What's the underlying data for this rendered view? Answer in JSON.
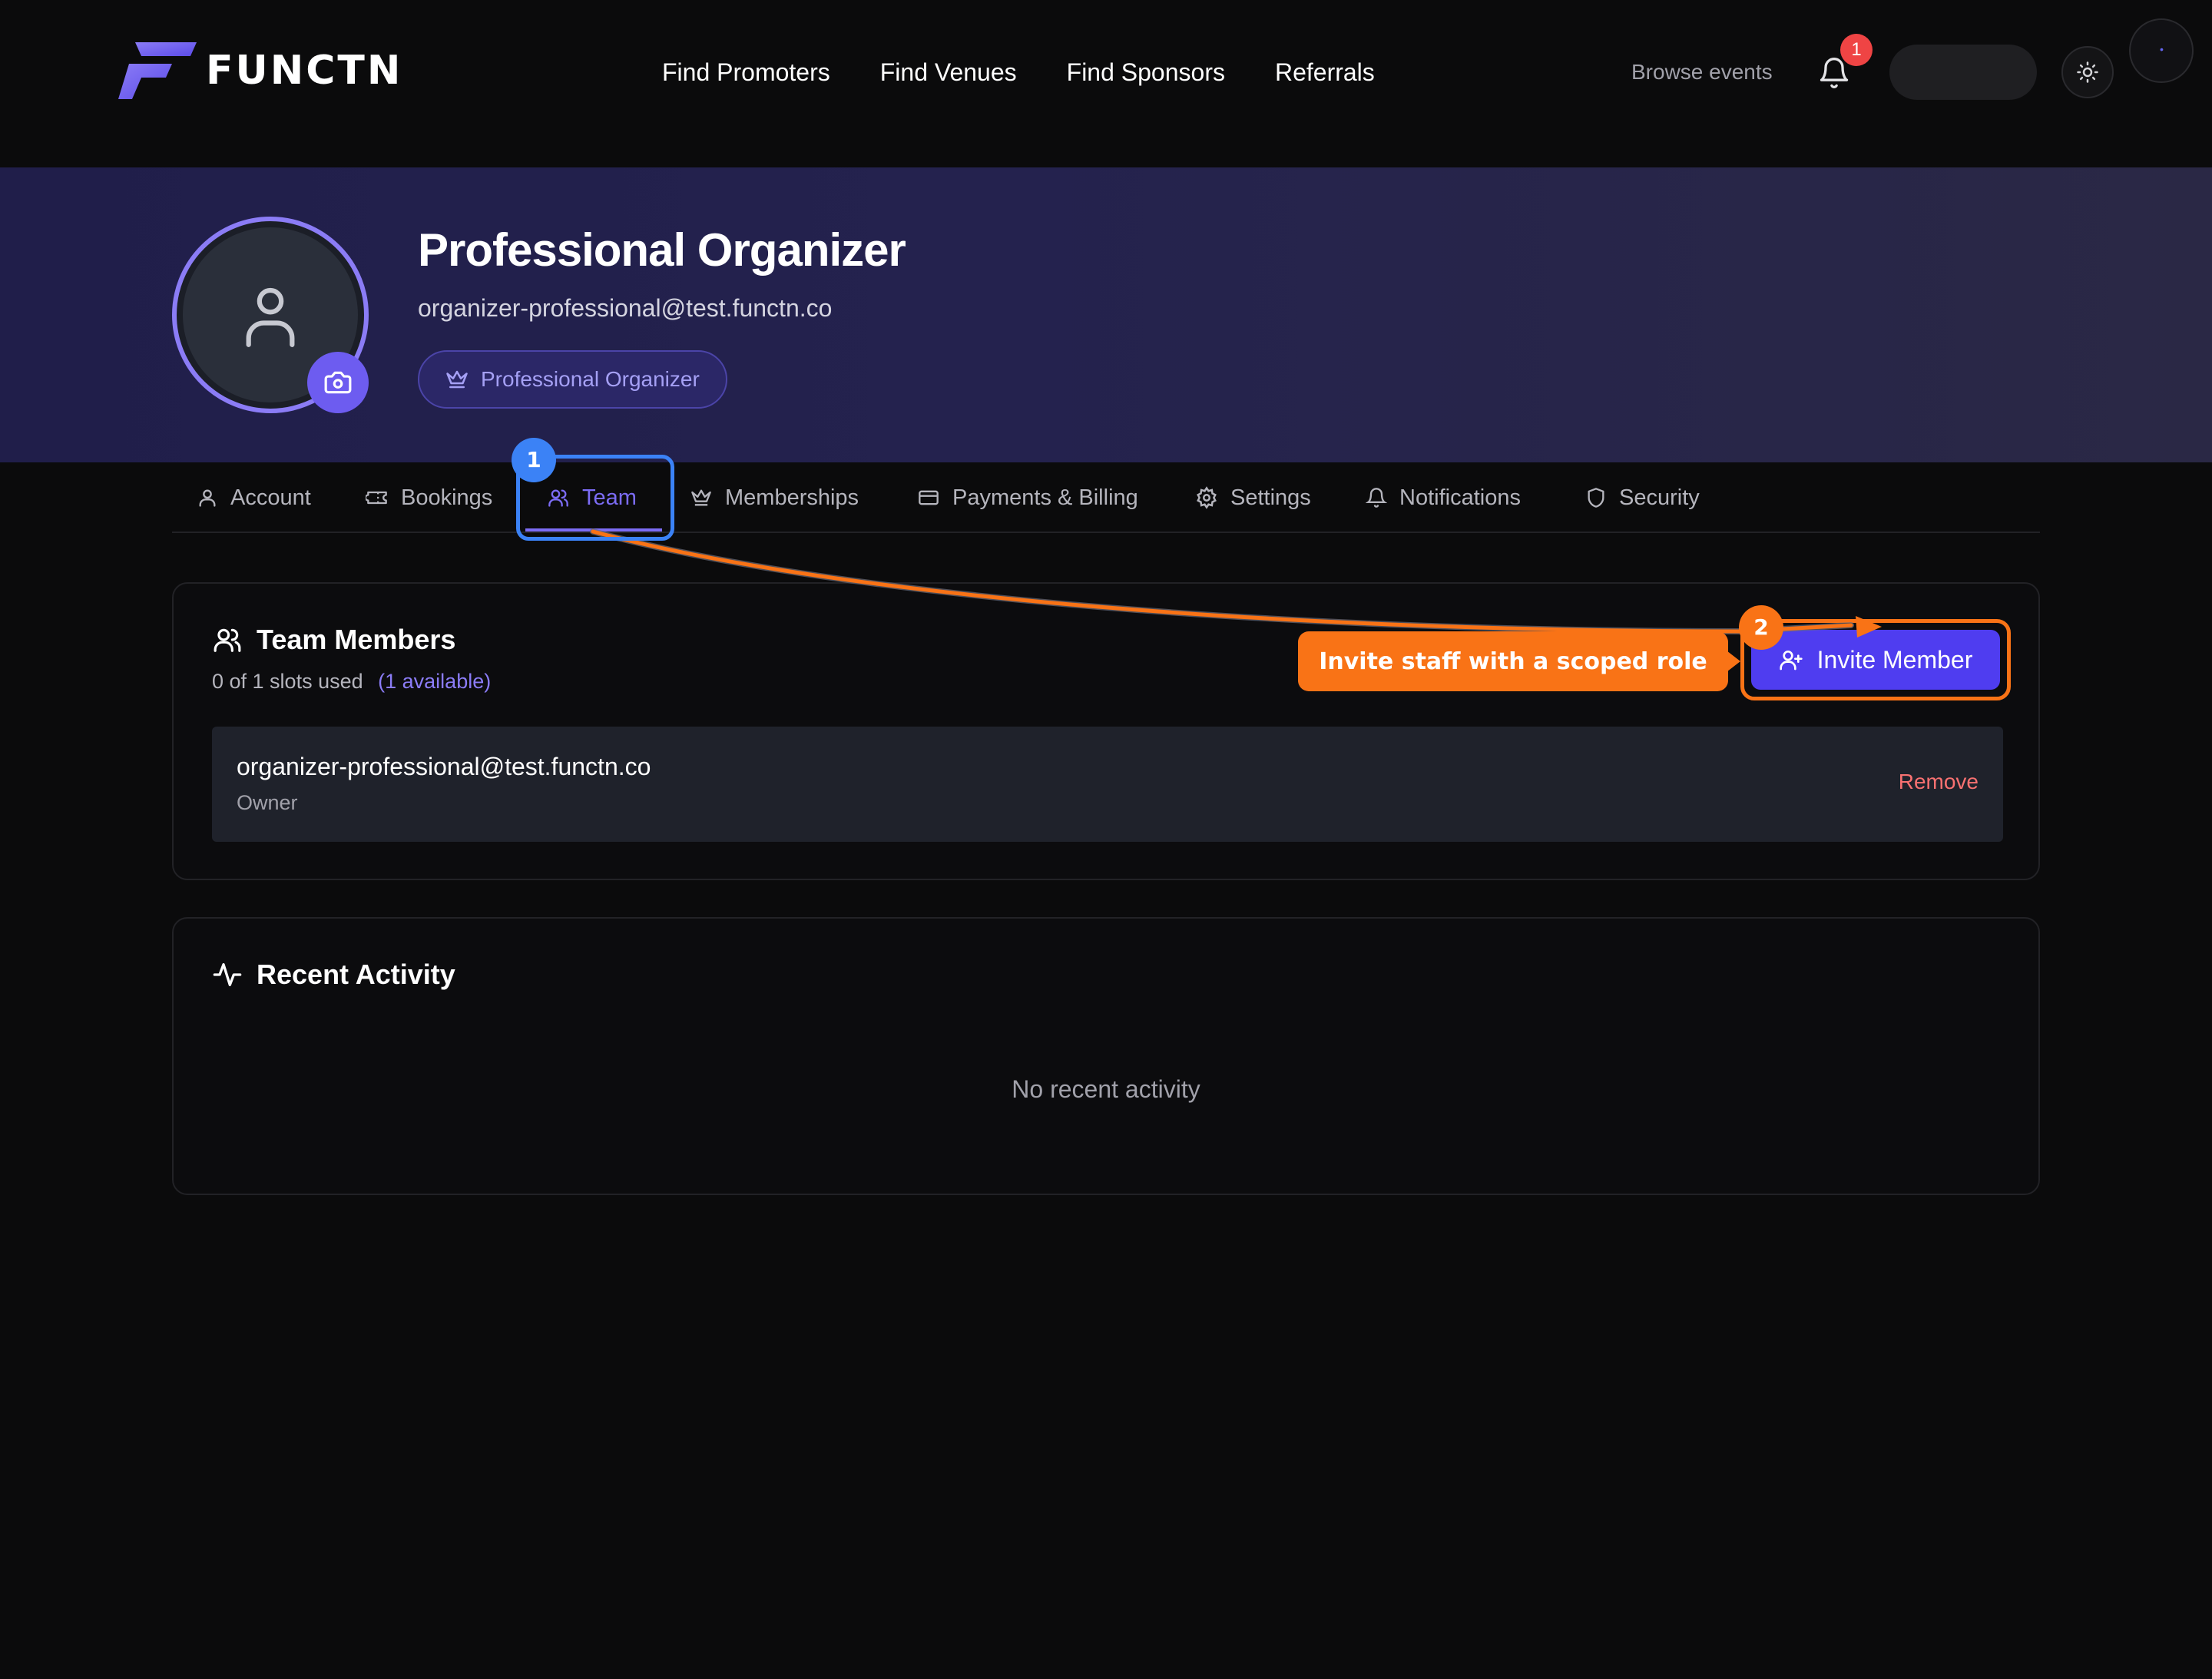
{
  "header": {
    "logo_text": "FUNCTN",
    "nav": [
      "Find Promoters",
      "Find Venues",
      "Find Sponsors",
      "Referrals"
    ],
    "browse_label": "Browse events",
    "notification_count": "1"
  },
  "profile": {
    "name": "Professional Organizer",
    "email": "organizer-professional@test.functn.co",
    "role_badge": "Professional Organizer"
  },
  "tabs": [
    {
      "label": "Account",
      "icon": "user-icon"
    },
    {
      "label": "Bookings",
      "icon": "ticket-icon"
    },
    {
      "label": "Team",
      "icon": "users-icon",
      "active": true
    },
    {
      "label": "Memberships",
      "icon": "crown-icon"
    },
    {
      "label": "Payments & Billing",
      "icon": "credit-card-icon"
    },
    {
      "label": "Settings",
      "icon": "gear-icon"
    },
    {
      "label": "Notifications",
      "icon": "bell-icon"
    },
    {
      "label": "Security",
      "icon": "shield-icon"
    }
  ],
  "team": {
    "title": "Team Members",
    "slots_text": "0 of 1 slots used",
    "available_text": "(1 available)",
    "invite_label": "Invite Member",
    "members": [
      {
        "email": "organizer-professional@test.functn.co",
        "role": "Owner",
        "action": "Remove"
      }
    ]
  },
  "activity": {
    "title": "Recent Activity",
    "empty_text": "No recent activity"
  },
  "annotations": {
    "step1": "1",
    "step2": "2",
    "callout": "Invite staff with a scoped role"
  },
  "colors": {
    "accent": "#7c6cf5",
    "invite_button": "#4f3df0",
    "annotation_orange": "#f97316",
    "annotation_blue": "#3b82f6",
    "remove": "#f87171"
  }
}
